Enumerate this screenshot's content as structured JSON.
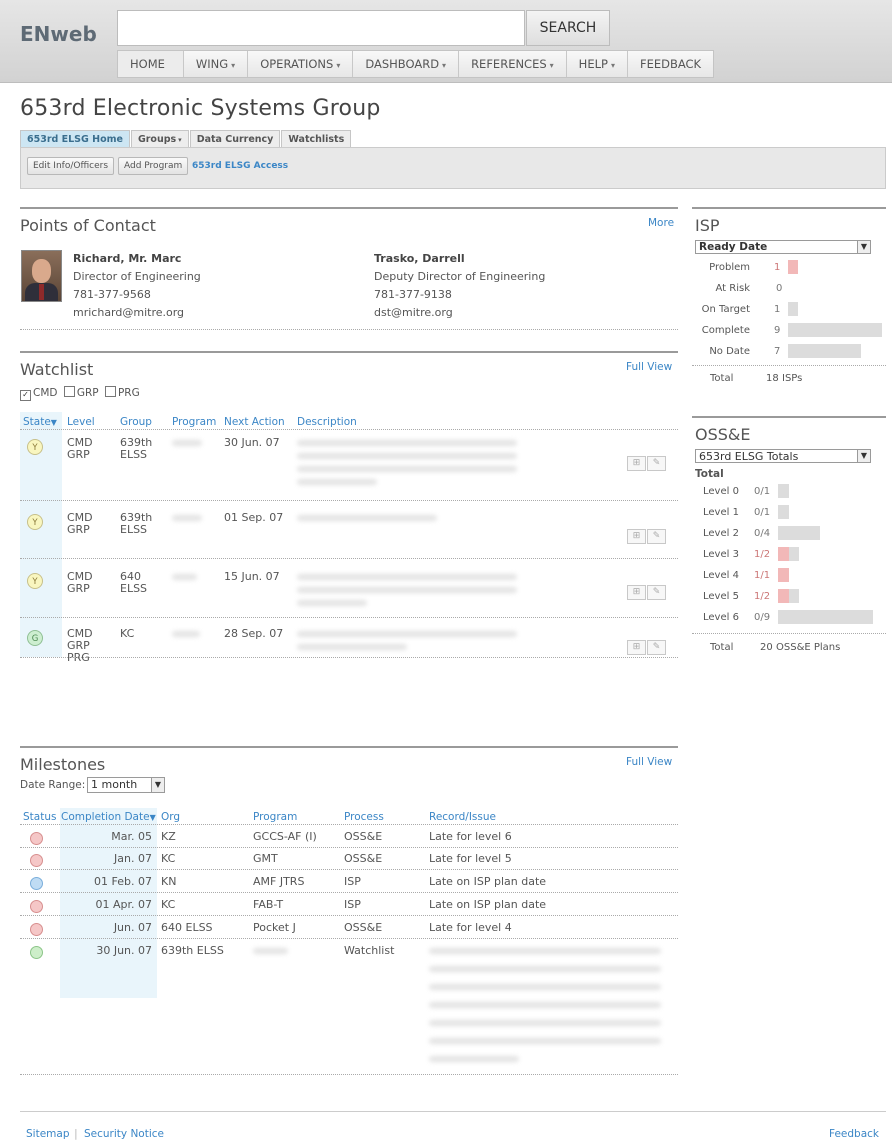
{
  "app": {
    "logo": "ENweb"
  },
  "search": {
    "placeholder": "",
    "button_label": "SEARCH"
  },
  "nav": {
    "home": "HOME",
    "wing": "WING",
    "operations": "OPERATIONS",
    "dashboard": "DASHBOARD",
    "references": "REFERENCES",
    "help": "HELP",
    "feedback": "FEEDBACK",
    "dropdown_glyph": "▾"
  },
  "page": {
    "title": "653rd Electronic Systems Group"
  },
  "subtabs": {
    "home": "653rd ELSG Home",
    "groups": "Groups",
    "data_currency": "Data Currency",
    "watchlists": "Watchlists"
  },
  "actions": {
    "edit_info": "Edit Info/Officers",
    "add_program": "Add Program",
    "access": "653rd ELSG Access"
  },
  "poc": {
    "title": "Points of Contact",
    "more": "More",
    "contacts": [
      {
        "name": "Richard, Mr. Marc",
        "role": "Director of Engineering",
        "phone": "781-377-9568",
        "email": "mrichard@mitre.org"
      },
      {
        "name": "Trasko, Darrell",
        "role": "Deputy Director of Engineering",
        "phone": "781-377-9138",
        "email": "dst@mitre.org"
      }
    ]
  },
  "watchlist": {
    "title": "Watchlist",
    "full_view": "Full View",
    "filters": {
      "cmd": "CMD",
      "grp": "GRP",
      "prg": "PRG",
      "check_glyph": "✓"
    },
    "headers": {
      "state": "State",
      "level": "Level",
      "group": "Group",
      "program": "Program",
      "next_action": "Next Action",
      "description": "Description",
      "sort_glyph": "▼"
    },
    "rows": [
      {
        "state": "Y",
        "level": "CMD\nGRP",
        "group": "639th\nELSS",
        "next_action": "30 Jun. 07"
      },
      {
        "state": "Y",
        "level": "CMD\nGRP",
        "group": "639th\nELSS",
        "next_action": "01 Sep. 07"
      },
      {
        "state": "Y",
        "level": "CMD\nGRP",
        "group": "640\nELSS",
        "next_action": "15 Jun. 07"
      },
      {
        "state": "G",
        "level": "CMD\nGRP\nPRG",
        "group": "KC",
        "next_action": "28 Sep. 07"
      }
    ],
    "icons": {
      "grid": "⊞",
      "edit": "✎"
    }
  },
  "milestones": {
    "title": "Milestones",
    "full_view": "Full View",
    "date_range_label": "Date Range:",
    "date_range_value": "1 month",
    "headers": {
      "status": "Status",
      "completion_date": "Completion Date",
      "org": "Org",
      "program": "Program",
      "process": "Process",
      "record_issue": "Record/Issue",
      "sort_glyph": "▼"
    },
    "rows": [
      {
        "status": "red",
        "date": "Mar. 05",
        "org": "KZ",
        "program": "GCCS-AF (I)",
        "process": "OSS&E",
        "issue": "Late for level 6"
      },
      {
        "status": "red",
        "date": "Jan. 07",
        "org": "KC",
        "program": "GMT",
        "process": "OSS&E",
        "issue": "Late for level 5"
      },
      {
        "status": "blue",
        "date": "01 Feb. 07",
        "org": "KN",
        "program": "AMF JTRS",
        "process": "ISP",
        "issue": "Late on ISP plan date"
      },
      {
        "status": "red",
        "date": "01 Apr. 07",
        "org": "KC",
        "program": "FAB-T",
        "process": "ISP",
        "issue": "Late on ISP plan date"
      },
      {
        "status": "red",
        "date": "Jun. 07",
        "org": "640 ELSS",
        "program": "Pocket J",
        "process": "OSS&E",
        "issue": "Late for level 4"
      },
      {
        "status": "green",
        "date": "30 Jun. 07",
        "org": "639th ELSS",
        "program": "",
        "process": "Watchlist",
        "issue": ""
      }
    ]
  },
  "isp": {
    "title": "ISP",
    "select_value": "Ready Date",
    "select_arrow": "▼",
    "rows": [
      {
        "label": "Problem",
        "value": "1",
        "color": "#f2b8b8"
      },
      {
        "label": "At Risk",
        "value": "0",
        "color": "#dcdcdc"
      },
      {
        "label": "On Target",
        "value": "1",
        "color": "#dcdcdc"
      },
      {
        "label": "Complete",
        "value": "9",
        "color": "#dcdcdc"
      },
      {
        "label": "No Date",
        "value": "7",
        "color": "#dcdcdc"
      }
    ],
    "total_label": "Total",
    "total_value": "18",
    "total_unit": "ISPs"
  },
  "osse": {
    "title": "OSS&E",
    "select_value": "653rd ELSG Totals",
    "select_arrow": "▼",
    "subhead": "Total",
    "rows": [
      {
        "label": "Level 0",
        "value": "0/1",
        "fraction": 0.0
      },
      {
        "label": "Level 1",
        "value": "0/1",
        "fraction": 0.0
      },
      {
        "label": "Level 2",
        "value": "0/4",
        "fraction": 0.0
      },
      {
        "label": "Level 3",
        "value": "1/2",
        "fraction": 0.5
      },
      {
        "label": "Level 4",
        "value": "1/1",
        "fraction": 1.0
      },
      {
        "label": "Level 5",
        "value": "1/2",
        "fraction": 0.5
      },
      {
        "label": "Level 6",
        "value": "0/9",
        "fraction": 0.0
      }
    ],
    "total_label": "Total",
    "total_value": "20",
    "total_unit": "OSS&E Plans"
  },
  "footer": {
    "sitemap": "Sitemap",
    "security": "Security Notice",
    "feedback": "Feedback"
  },
  "colors": {
    "accent": "#3b86c6",
    "problem": "#f2b8b8",
    "neutral_bar": "#dcdcdc"
  }
}
